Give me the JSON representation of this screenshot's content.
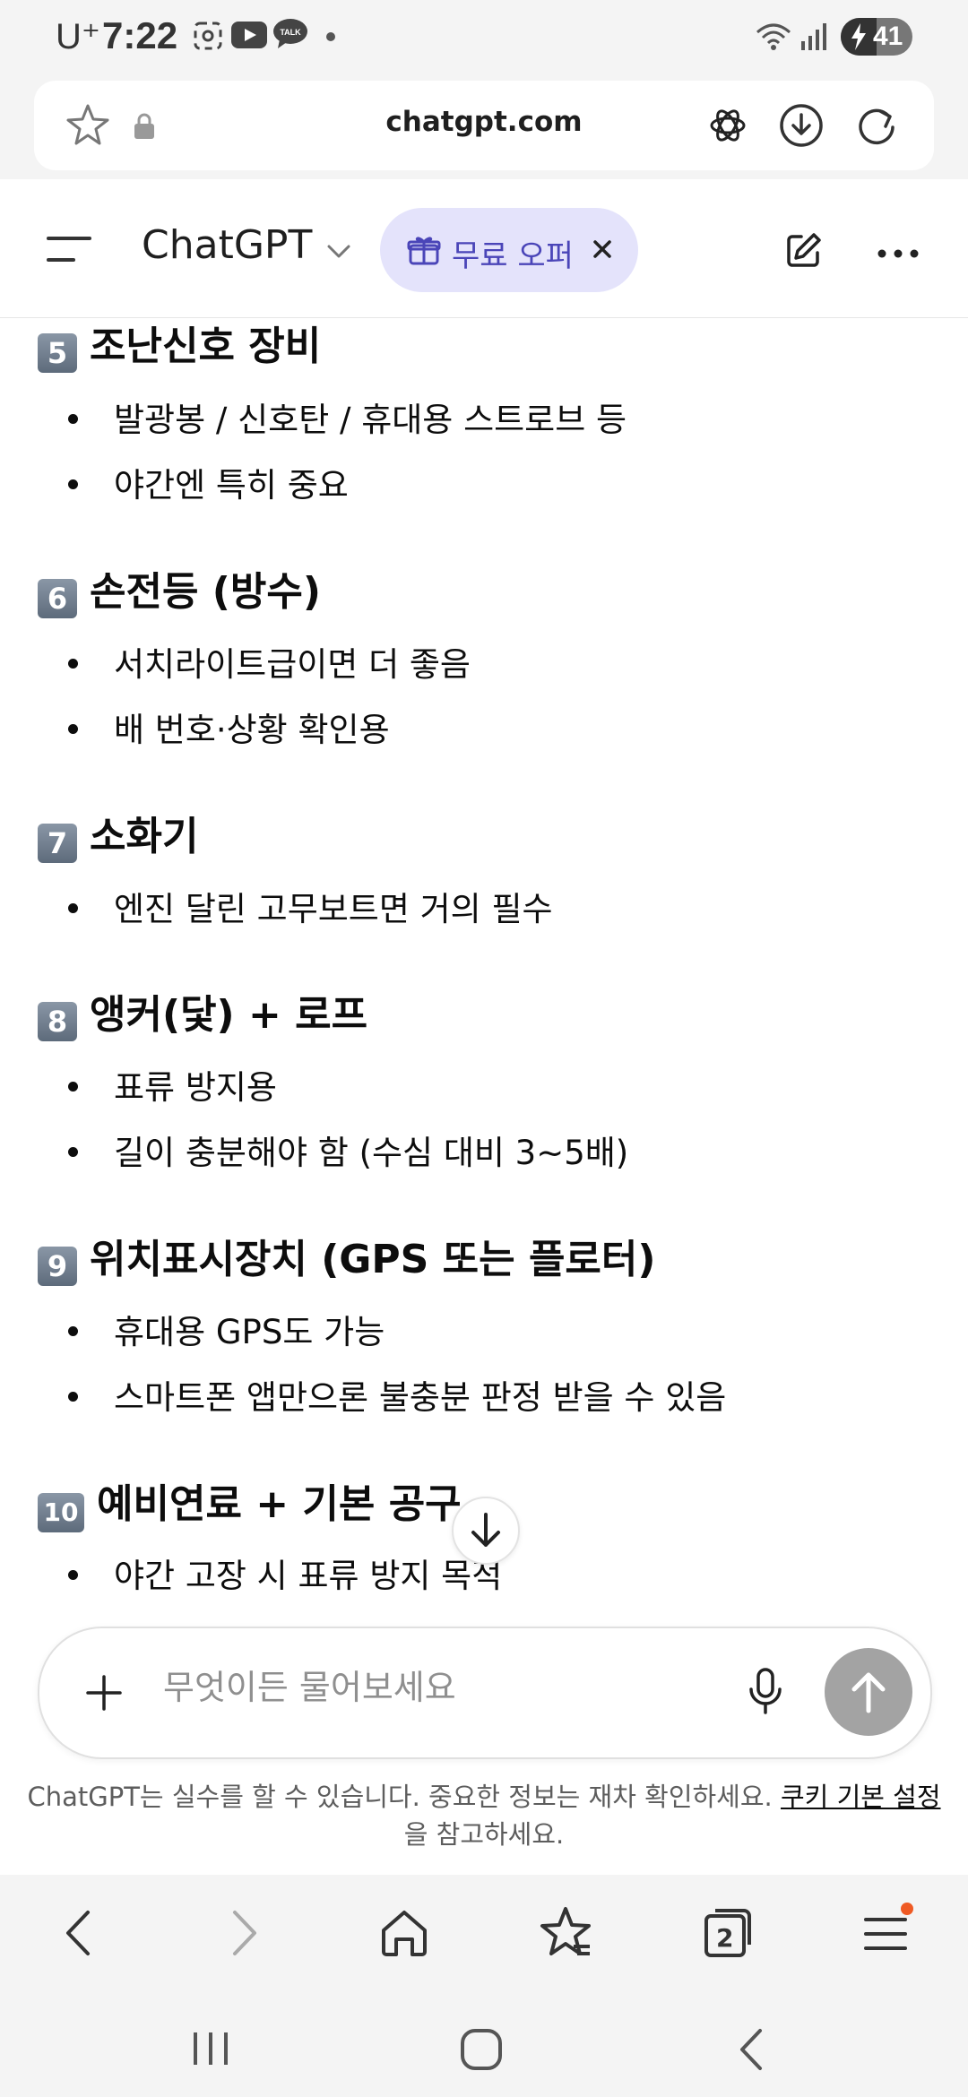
{
  "status_bar": {
    "carrier": "U⁺",
    "time": "7:22",
    "battery": "41"
  },
  "browser": {
    "url": "chatgpt.com"
  },
  "header": {
    "title": "ChatGPT",
    "offer_label": "무료 오퍼"
  },
  "content": {
    "sections": [
      {
        "num": "5",
        "title": "조난신호 장비",
        "bullets": [
          "발광봉 / 신호탄 / 휴대용 스트로브 등",
          "야간엔 특히 중요"
        ]
      },
      {
        "num": "6",
        "title": "손전등 (방수)",
        "bullets": [
          "서치라이트급이면 더 좋음",
          "배 번호·상황 확인용"
        ]
      },
      {
        "num": "7",
        "title": "소화기",
        "bullets": [
          "엔진 달린 고무보트면 거의 필수"
        ]
      },
      {
        "num": "8",
        "title": "앵커(닻) + 로프",
        "bullets": [
          "표류 방지용",
          "길이 충분해야 함 (수심 대비 3~5배)"
        ]
      },
      {
        "num": "9",
        "title": "위치표시장치 (GPS 또는 플로터)",
        "bullets": [
          "휴대용 GPS도 가능",
          "스마트폰 앱만으론 불충분 판정 받을 수 있음"
        ]
      },
      {
        "num": "10",
        "title": "예비연료 + 기본 공구",
        "bullets": [
          "야간 고장 시 표류 방지 목적"
        ]
      }
    ]
  },
  "composer": {
    "placeholder": "무엇이든 물어보세요"
  },
  "disclaimer": {
    "text": "ChatGPT는 실수를 할 수 있습니다. 중요한 정보는 재차 확인하세요.",
    "link": "쿠키 기본 설정",
    "suffix": "을 참고하세요."
  },
  "browser_nav": {
    "tab_count": "2"
  }
}
